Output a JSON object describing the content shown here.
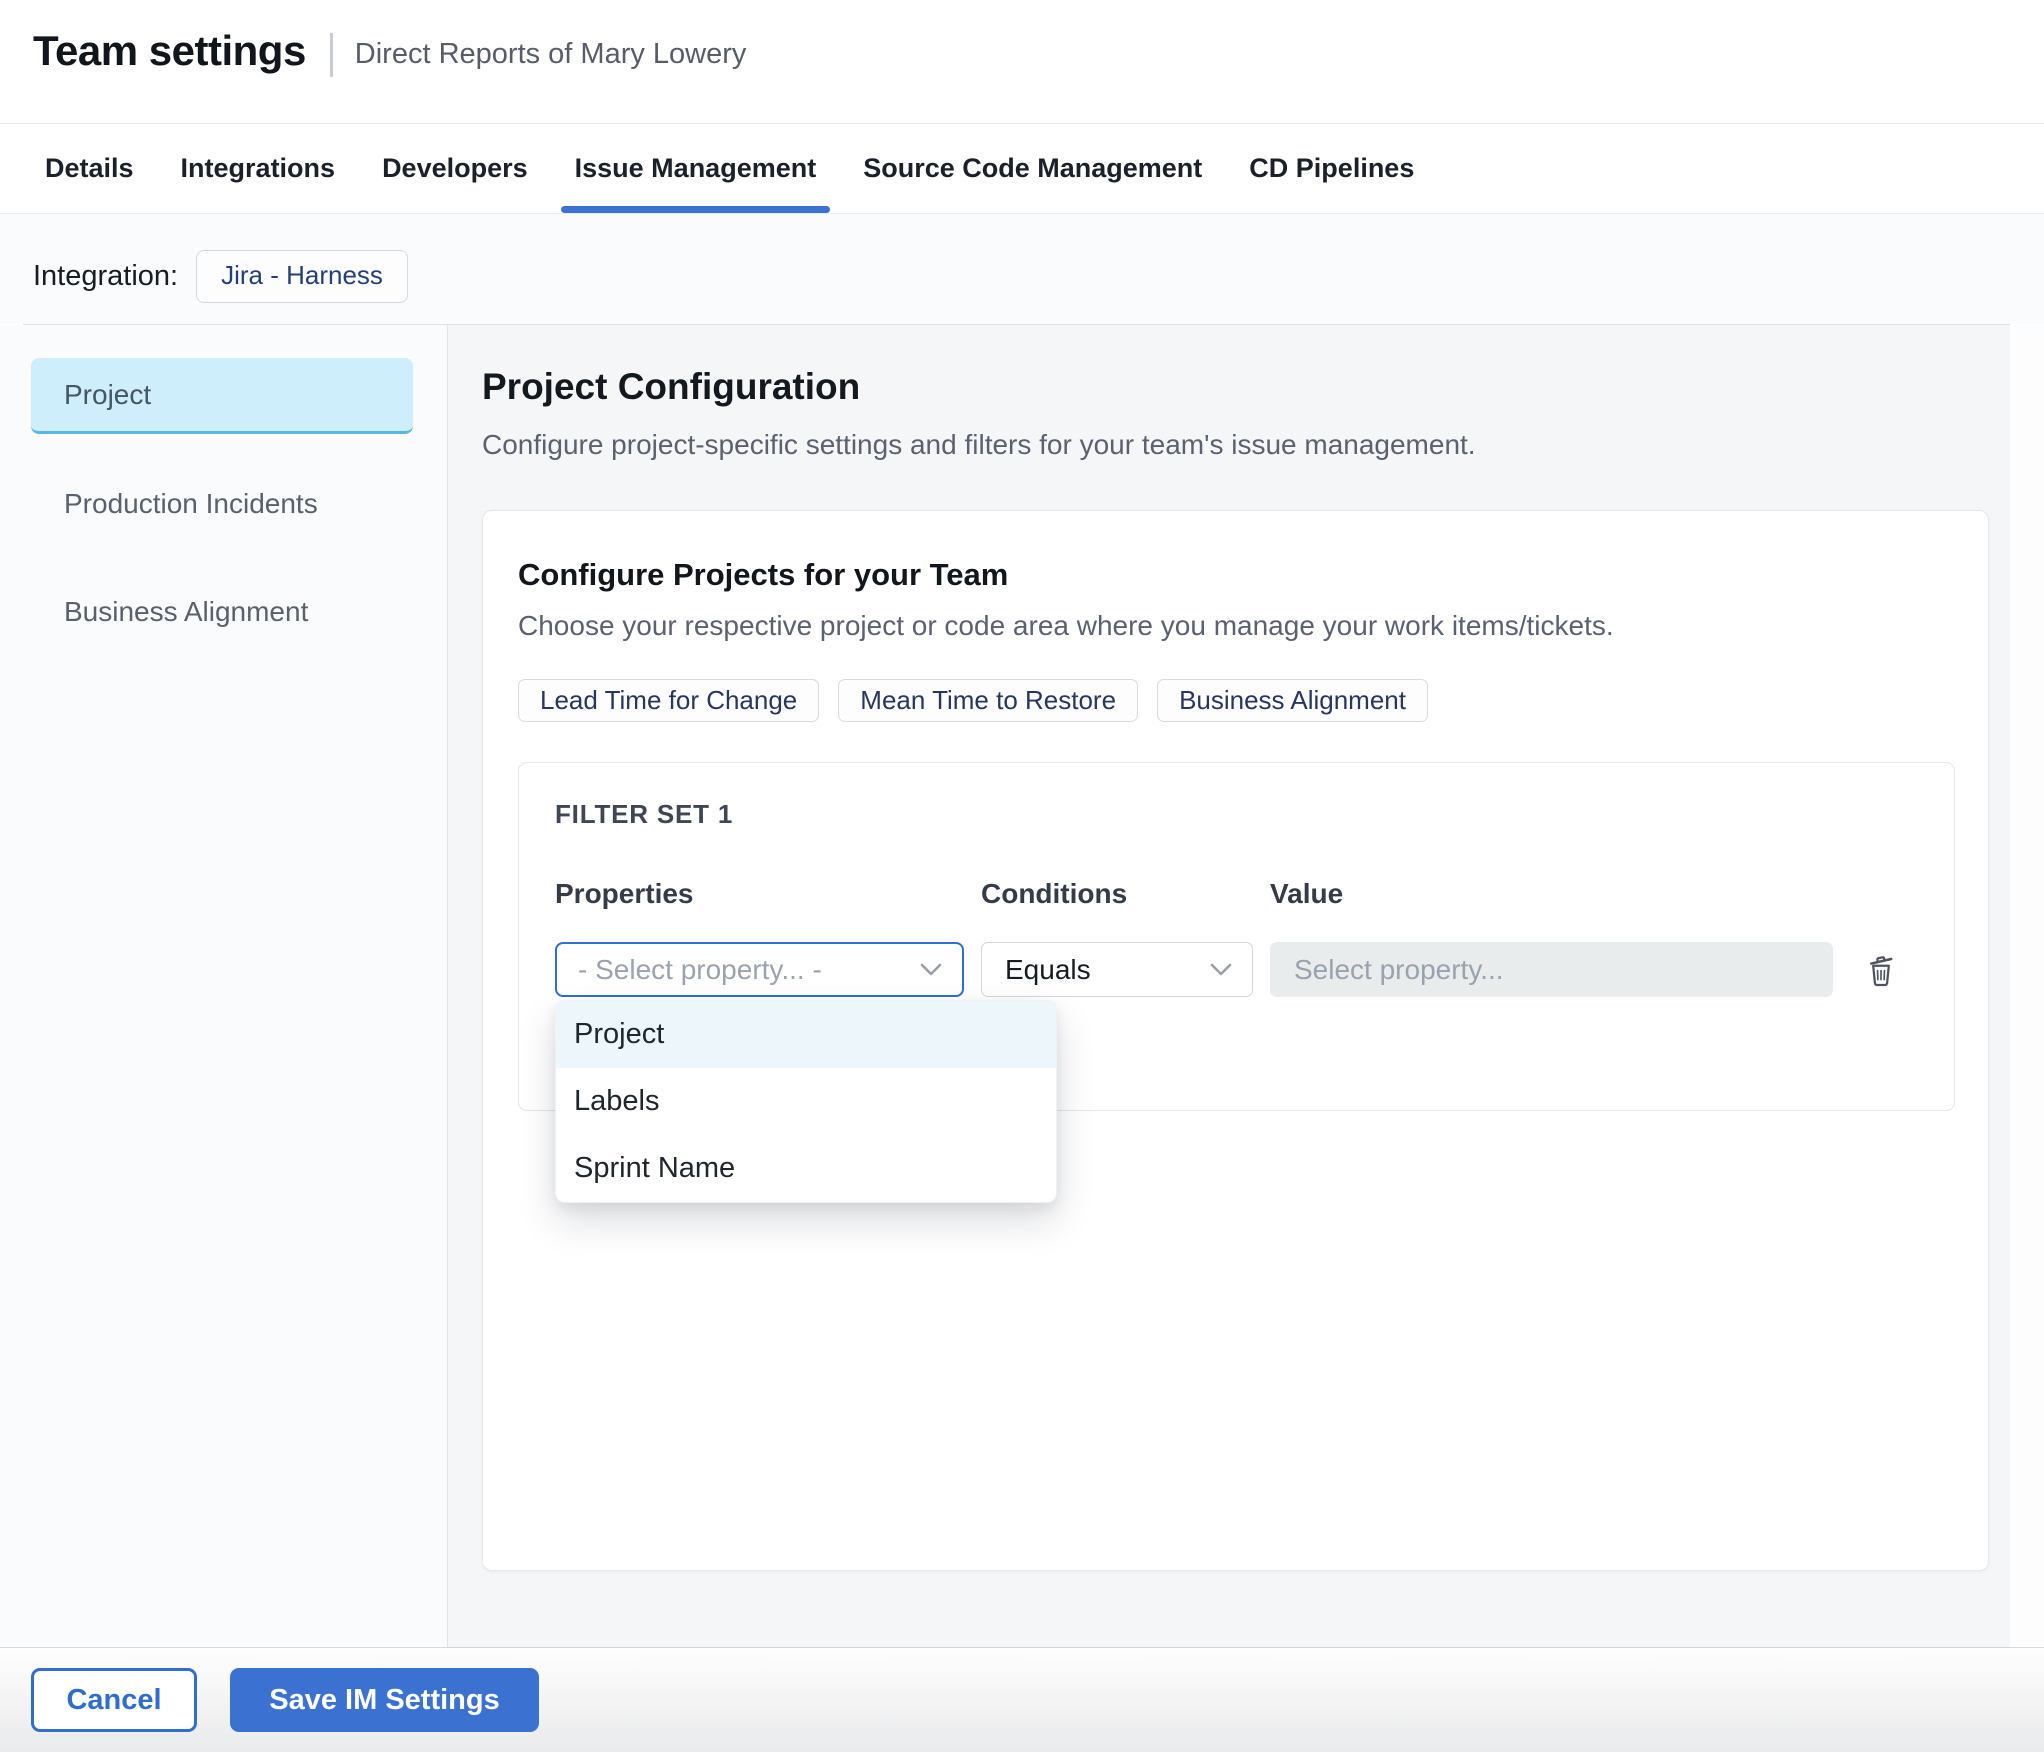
{
  "header": {
    "title": "Team settings",
    "subtitle": "Direct Reports of Mary Lowery"
  },
  "tabs": [
    {
      "label": "Details",
      "active": false
    },
    {
      "label": "Integrations",
      "active": false
    },
    {
      "label": "Developers",
      "active": false
    },
    {
      "label": "Issue Management",
      "active": true
    },
    {
      "label": "Source Code Management",
      "active": false
    },
    {
      "label": "CD Pipelines",
      "active": false
    }
  ],
  "integration": {
    "label": "Integration:",
    "value": "Jira - Harness"
  },
  "sidebar": {
    "items": [
      {
        "label": "Project",
        "active": true
      },
      {
        "label": "Production Incidents",
        "active": false
      },
      {
        "label": "Business Alignment",
        "active": false
      }
    ]
  },
  "main": {
    "title": "Project Configuration",
    "subtitle": "Configure project-specific settings and filters for your team's issue management.",
    "card": {
      "title": "Configure Projects for your Team",
      "description": "Choose your respective project or code area where you manage your work items/tickets.",
      "metric_chips": [
        "Lead Time for Change",
        "Mean Time to Restore",
        "Business Alignment"
      ],
      "filter_set": {
        "title": "FILTER SET 1",
        "columns": [
          "Properties",
          "Conditions",
          "Value"
        ],
        "properties_placeholder": "- Select property... -",
        "condition_value": "Equals",
        "value_placeholder": "Select property...",
        "dropdown": {
          "options": [
            "Project",
            "Labels",
            "Sprint Name"
          ],
          "highlighted_option": "Project"
        }
      }
    }
  },
  "footer": {
    "cancel_label": "Cancel",
    "save_label": "Save IM Settings"
  },
  "colors": {
    "accent_blue": "#3b72d2",
    "focused_border_blue": "#2d6fd3",
    "selected_sidebar_bg": "#cdeefa",
    "selected_sidebar_border": "#55b9e3",
    "dropdown_highlight_bg": "#edf6fb",
    "disabled_input_bg": "#e8eced",
    "chip_text_navy": "#28375f",
    "main_background": "#f5f6f8"
  }
}
